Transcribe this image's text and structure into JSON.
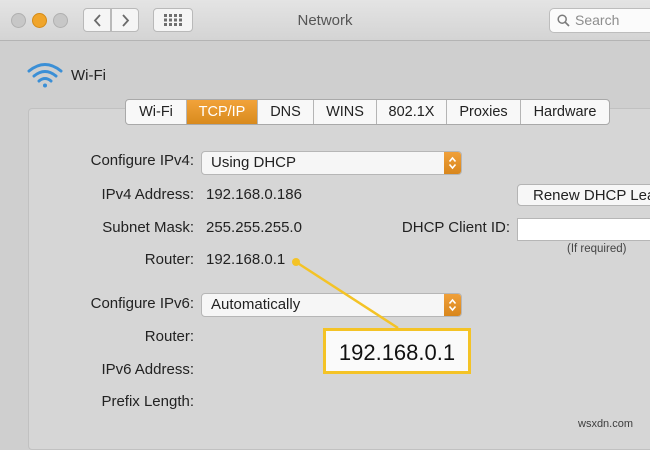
{
  "window": {
    "title": "Network",
    "search_placeholder": "Search"
  },
  "service": {
    "label": "Wi-Fi",
    "icon": "wifi-icon"
  },
  "tabs": [
    "Wi-Fi",
    "TCP/IP",
    "DNS",
    "WINS",
    "802.1X",
    "Proxies",
    "Hardware"
  ],
  "active_tab": "TCP/IP",
  "ipv4": {
    "configure_label": "Configure IPv4:",
    "configure_value": "Using DHCP",
    "address_label": "IPv4 Address:",
    "address_value": "192.168.0.186",
    "subnet_label": "Subnet Mask:",
    "subnet_value": "255.255.255.0",
    "router_label": "Router:",
    "router_value": "192.168.0.1"
  },
  "dhcp": {
    "renew_button": "Renew DHCP Lease",
    "client_id_label": "DHCP Client ID:",
    "client_id_value": "",
    "hint": "(If required)"
  },
  "ipv6": {
    "configure_label": "Configure IPv6:",
    "configure_value": "Automatically",
    "router_label": "Router:",
    "address_label": "IPv6 Address:",
    "prefix_label": "Prefix Length:"
  },
  "callout": {
    "text": "192.168.0.1"
  },
  "watermark": "wsxdn.com",
  "colors": {
    "accent": "#e09324",
    "highlight": "#f4c326",
    "panel": "#d6d6d6"
  }
}
